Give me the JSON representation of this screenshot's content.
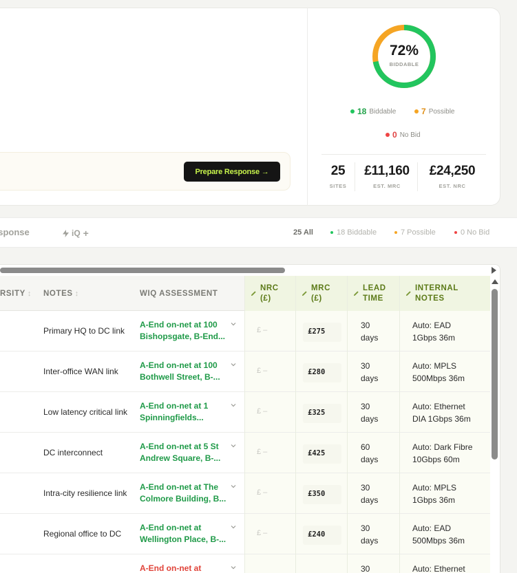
{
  "score": {
    "percent_label": "72%",
    "percent": 72,
    "caption": "BIDDABLE",
    "colors": {
      "biddable": "#22c55e",
      "possible": "#f5a524",
      "nobid": "#ef4444"
    }
  },
  "legend": [
    {
      "count": "18",
      "label": "Biddable",
      "color": "#22c55e"
    },
    {
      "count": "7",
      "label": "Possible",
      "color": "#f5a524"
    },
    {
      "count": "0",
      "label": "No Bid",
      "color": "#ef4444"
    }
  ],
  "stats": [
    {
      "value": "25",
      "label": "SITES"
    },
    {
      "value": "£11,160",
      "label": "EST. MRC"
    },
    {
      "value": "£24,250",
      "label": "EST. NRC"
    }
  ],
  "cta": {
    "label": "Prepare Response →"
  },
  "tabs": {
    "response": "esponse",
    "iq": "iQ",
    "iq_plus": "+"
  },
  "filters": [
    {
      "label": "25 All"
    },
    {
      "label": "18 Biddable",
      "color": "#22c55e"
    },
    {
      "label": "7 Possible",
      "color": "#f5a524"
    },
    {
      "label": "0 No Bid",
      "color": "#ef4444"
    }
  ],
  "table": {
    "headers": {
      "diversity": "RSITY",
      "notes": "NOTES",
      "assessment": "WIQ ASSESSMENT",
      "nrc_1": "NRC",
      "nrc_2": "(£)",
      "mrc_1": "MRC",
      "mrc_2": "(£)",
      "lead_1": "LEAD",
      "lead_2": "TIME",
      "inotes_1": "INTERNAL",
      "inotes_2": "NOTES"
    },
    "rows": [
      {
        "notes": "Primary HQ to DC link",
        "assess_1": "A-End on-net at 100",
        "assess_2": "Bishopsgate, B-End...",
        "nrc": "£ –",
        "mrc": "£275",
        "lead_1": "30",
        "lead_2": "days",
        "inotes_1": "Auto: EAD",
        "inotes_2": "1Gbps 36m"
      },
      {
        "notes": "Inter-office WAN link",
        "assess_1": "A-End on-net at 100",
        "assess_2": "Bothwell Street, B-...",
        "nrc": "£ –",
        "mrc": "£280",
        "lead_1": "30",
        "lead_2": "days",
        "inotes_1": "Auto: MPLS",
        "inotes_2": "500Mbps 36m"
      },
      {
        "notes": "Low latency critical link",
        "assess_1": "A-End on-net at 1",
        "assess_2": "Spinningfields...",
        "nrc": "£ –",
        "mrc": "£325",
        "lead_1": "30",
        "lead_2": "days",
        "inotes_1": "Auto: Ethernet",
        "inotes_2": "DIA 1Gbps 36m"
      },
      {
        "notes": "DC interconnect",
        "assess_1": "A-End on-net at 5 St",
        "assess_2": "Andrew Square, B-...",
        "nrc": "£ –",
        "mrc": "£425",
        "lead_1": "60",
        "lead_2": "days",
        "inotes_1": "Auto: Dark Fibre",
        "inotes_2": "10Gbps 60m"
      },
      {
        "notes": "Intra-city resilience link",
        "assess_1": "A-End on-net at The",
        "assess_2": "Colmore Building, B...",
        "nrc": "£ –",
        "mrc": "£350",
        "lead_1": "30",
        "lead_2": "days",
        "inotes_1": "Auto: MPLS",
        "inotes_2": "1Gbps 36m"
      },
      {
        "notes": "Regional office to DC",
        "assess_1": "A-End on-net at",
        "assess_2": "Wellington Place, B-...",
        "nrc": "£ –",
        "mrc": "£240",
        "lead_1": "30",
        "lead_2": "days",
        "inotes_1": "Auto: EAD",
        "inotes_2": "500Mbps 36m"
      },
      {
        "notes": "",
        "assess_1": "A-End on-net at",
        "assess_2": "",
        "nrc": "",
        "mrc": "",
        "lead_1": "30",
        "lead_2": "",
        "inotes_1": "Auto: Ethernet",
        "inotes_2": ""
      }
    ]
  }
}
